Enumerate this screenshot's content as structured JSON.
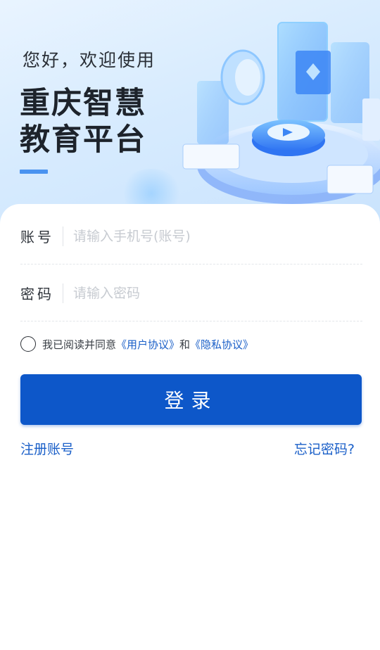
{
  "hero": {
    "welcome": "您好，欢迎使用",
    "title_line1": "重庆智慧",
    "title_line2": "教育平台"
  },
  "form": {
    "account_label": "账号",
    "account_placeholder": "请输入手机号(账号)",
    "password_label": "密码",
    "password_placeholder": "请输入密码",
    "agreement_prefix": "我已阅读并同意",
    "user_agreement": "《用户协议》",
    "agreement_and": "和",
    "privacy_agreement": "《隐私协议》",
    "login_label": "登录",
    "register_label": "注册账号",
    "forgot_label": "忘记密码?"
  },
  "colors": {
    "primary": "#0d57c9",
    "link": "#1a5fc8",
    "hero_bg": "#d7ebfe"
  }
}
